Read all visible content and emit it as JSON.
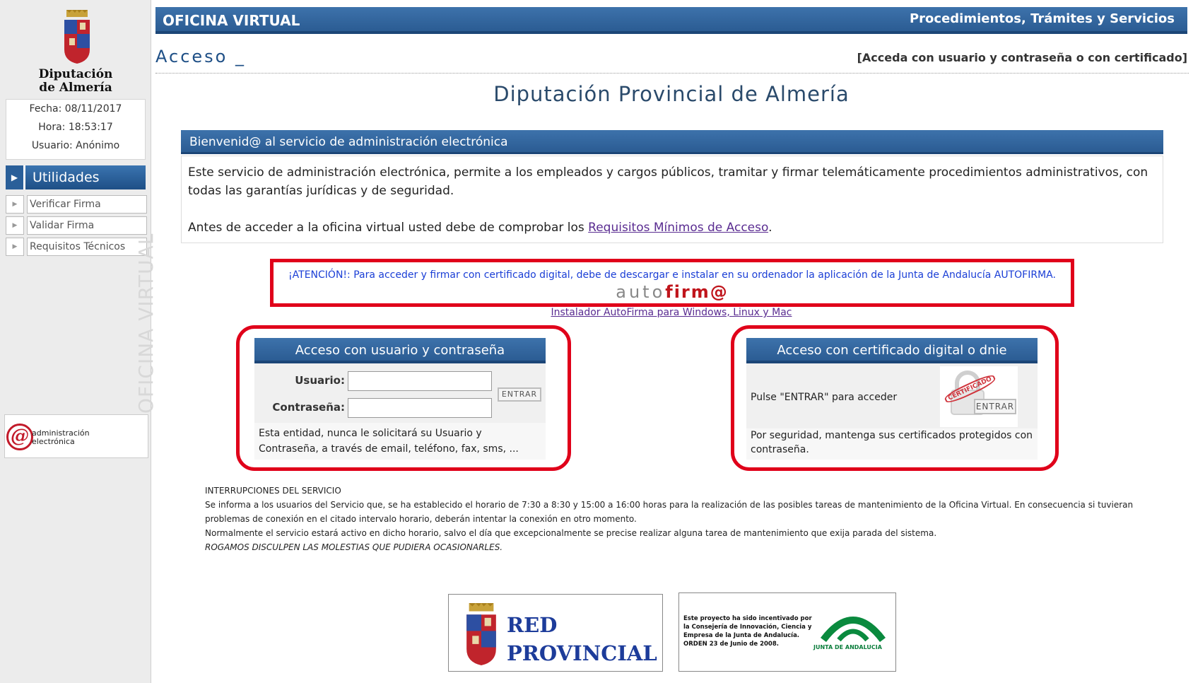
{
  "sidebar": {
    "org_name_line1": "Diputación",
    "org_name_line2": "de Almería",
    "fecha": "Fecha: 08/11/2017",
    "hora": "Hora: 18:53:17",
    "usuario": "Usuario: Anónimo",
    "utilidades_label": "Utilidades",
    "items": [
      {
        "label": "Verificar Firma"
      },
      {
        "label": "Validar Firma"
      },
      {
        "label": "Requisitos Técnicos"
      }
    ],
    "vertical_label": "OFICINA VIRTUAL",
    "admin_logo_line1": "administración",
    "admin_logo_line2": "electrónica"
  },
  "header": {
    "app_title": "OFICINA VIRTUAL",
    "right_title": "Procedimientos, Trámites y Servicios",
    "section_title": "Acceso _",
    "section_hint": "[Acceda con usuario y contraseña o con certificado]"
  },
  "main": {
    "title": "Diputación Provincial de Almería",
    "welcome_header": "Bienvenid@ al servicio de administración electrónica",
    "welcome_text": "Este servicio de administración electrónica, permite a los empleados y cargos públicos, tramitar y firmar telemáticamente procedimientos administrativos, con todas las garantías jurídicas y de seguridad.",
    "requisitos_prefix": "Antes de acceder a la oficina virtual usted debe de comprobar los ",
    "requisitos_link": "Requisitos Mínimos de Acceso",
    "requisitos_suffix": ".",
    "attention_text": "¡ATENCIÓN!: Para acceder y firmar con certificado digital, debe de descargar e instalar en su ordenador la aplicación de la Junta de Andalucía AUTOFIRMA.",
    "autofirma_logo_a": "auto",
    "autofirma_logo_b": "firm@",
    "installer_link": "Instalador AutoFirma para Windows, Linux y Mac"
  },
  "login_user": {
    "header": "Acceso con usuario y contraseña",
    "usuario_label": "Usuario:",
    "usuario_value": "",
    "password_label": "Contraseña:",
    "password_value": "",
    "entrar": "ENTRAR",
    "note": "Esta entidad, nunca le solicitará su Usuario y Contraseña, a través de email, teléfono, fax, sms, ..."
  },
  "login_cert": {
    "header": "Acceso con certificado digital o dnie",
    "prompt": "Pulse \"ENTRAR\" para acceder",
    "stamp_text": "CERTIFICADO",
    "entrar": "ENTRAR",
    "note": "Por seguridad, mantenga sus certificados protegidos con contraseña."
  },
  "interruptions": {
    "title": "INTERRUPCIONES DEL SERVICIO",
    "line1": "Se informa a los usuarios del Servicio que, se ha establecido el horario de 7:30 a 8:30 y 15:00 a 16:00 horas para la realización de las posibles tareas de mantenimiento de la Oficina Virtual. En consecuencia si tuvieran problemas de conexión en el citado intervalo horario, deberán intentar la conexión en otro momento.",
    "line2": "Normalmente el servicio estará activo en dicho horario, salvo el día que excepcionalmente se precise realizar alguna tarea de mantenimiento que exija parada del sistema.",
    "line3": "ROGAMOS DISCULPEN LAS MOLESTIAS QUE PUDIERA OCASIONARLES."
  },
  "footer": {
    "red_line1": "RED",
    "red_line2": "PROVINCIAL",
    "junta_text": "Este proyecto ha sido incentivado por la Consejería de Innovación, Ciencia y Empresa de la Junta de Andalucía. ORDEN 23 de Junio de 2008.",
    "junta_name": "JUNTA DE ANDALUCIA"
  },
  "colors": {
    "header_blue": "#2b5c93",
    "highlight_red": "#e0001a",
    "link_purple": "#5a2c91",
    "attention_blue": "#1a3ed6"
  }
}
